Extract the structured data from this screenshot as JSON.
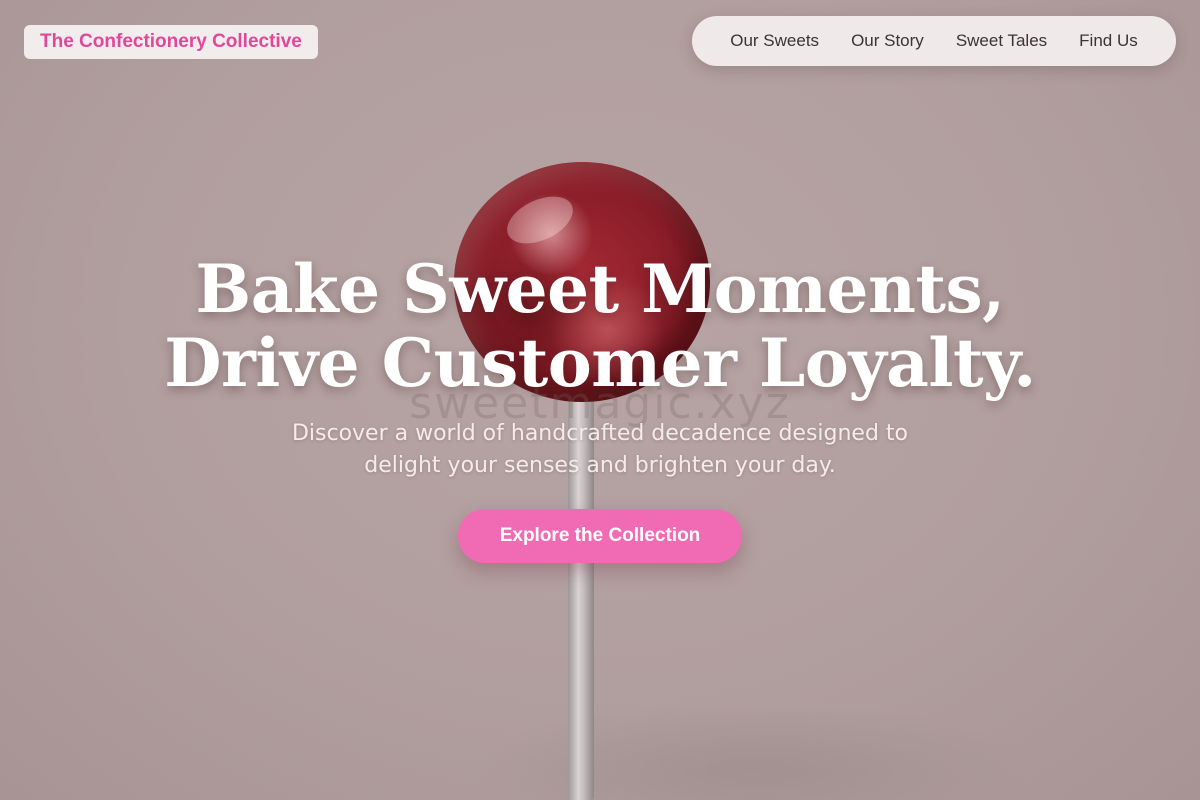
{
  "header": {
    "brand": "The Confectionery Collective",
    "nav": [
      {
        "label": "Our Sweets"
      },
      {
        "label": "Our Story"
      },
      {
        "label": "Sweet Tales"
      },
      {
        "label": "Find Us"
      }
    ]
  },
  "hero": {
    "headline_line1": "Bake Sweet Moments,",
    "headline_line2": "Drive Customer Loyalty.",
    "subtitle_line1": "Discover a world of handcrafted decadence designed to",
    "subtitle_line2": "delight your senses and brighten your day.",
    "cta_label": "Explore the Collection",
    "watermark": "sweetmagic.xyz"
  },
  "colors": {
    "brand": "#e0489a",
    "cta": "#f06bb4",
    "background": "#b09c9c"
  }
}
